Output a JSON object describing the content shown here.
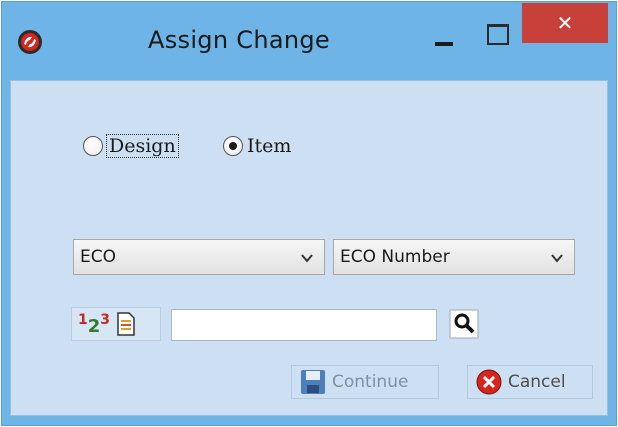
{
  "window": {
    "title": "Assign Change",
    "close_glyph": "✕",
    "colors": {
      "titlebar": "#6eb4e6",
      "client": "#cde0f3",
      "close": "#c7403a"
    }
  },
  "options": {
    "design_label": "Design",
    "item_label": "Item",
    "selected": "Item"
  },
  "change_type_select": {
    "value": "ECO"
  },
  "field_select": {
    "value": "ECO Number"
  },
  "search": {
    "value": "",
    "placeholder": ""
  },
  "numbering": {
    "digits": [
      "1",
      "2",
      "3"
    ]
  },
  "buttons": {
    "continue_label": "Continue",
    "cancel_label": "Cancel"
  },
  "icons": [
    "app-logo-icon",
    "minimize-icon",
    "maximize-icon",
    "close-icon",
    "chevron-down-icon",
    "numbering-icon",
    "document-icon",
    "search-icon",
    "save-icon",
    "cancel-icon"
  ]
}
